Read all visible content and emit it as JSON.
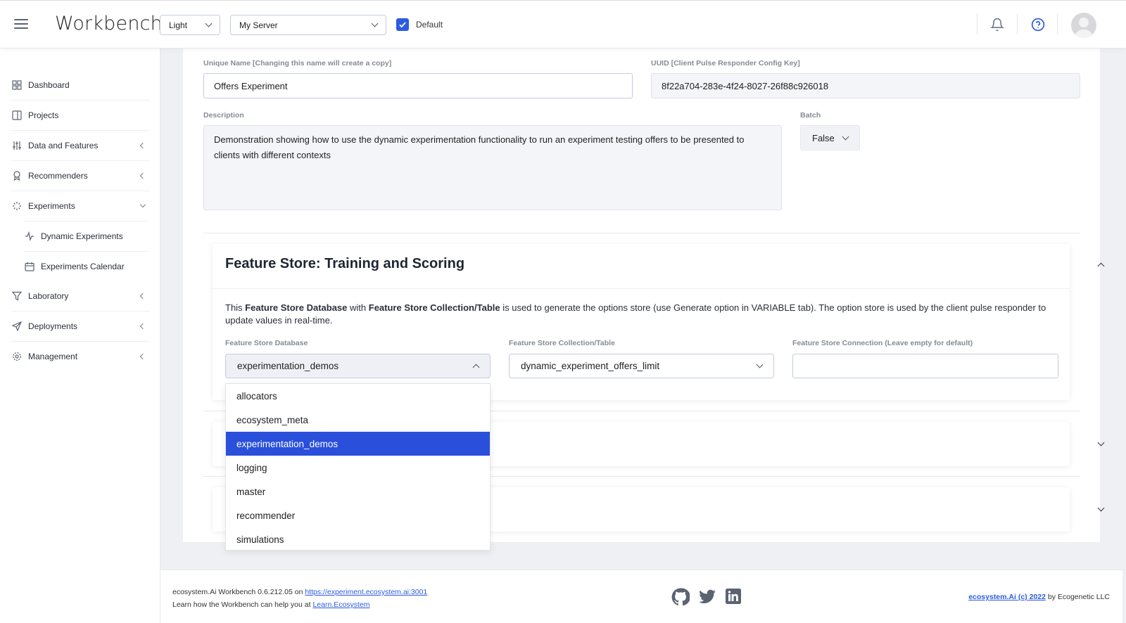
{
  "header": {
    "app_title": "Workbench",
    "theme_value": "Light",
    "server_value": "My Server",
    "default_checked": true,
    "default_label": "Default"
  },
  "sidebar": {
    "items": [
      {
        "label": "Dashboard",
        "icon": "grid-icon"
      },
      {
        "label": "Projects",
        "icon": "project-icon"
      },
      {
        "label": "Data and Features",
        "icon": "sliders-icon"
      },
      {
        "label": "Recommenders",
        "icon": "award-icon"
      },
      {
        "label": "Experiments",
        "icon": "loader-icon"
      },
      {
        "label": "Dynamic Experiments",
        "icon": "activity-icon"
      },
      {
        "label": "Experiments Calendar",
        "icon": "calendar-icon"
      },
      {
        "label": "Laboratory",
        "icon": "filter-icon"
      },
      {
        "label": "Deployments",
        "icon": "send-icon"
      },
      {
        "label": "Management",
        "icon": "settings-icon"
      }
    ]
  },
  "form": {
    "unique_name_label": "Unique Name [Changing this name will create a copy]",
    "unique_name_value": "Offers Experiment",
    "uuid_label": "UUID [Client Pulse Responder Config Key]",
    "uuid_value": "8f22a704-283e-4f24-8027-26f88c926018",
    "description_label": "Description",
    "description_value": "Demonstration showing how to use the dynamic experimentation functionality to run an experiment testing offers to be presented to clients with different contexts",
    "batch_label": "Batch",
    "batch_value": "False"
  },
  "feature_store": {
    "title": "Feature Store: Training and Scoring",
    "desc_1": "This ",
    "desc_b1": "Feature Store Database",
    "desc_2": " with ",
    "desc_b2": "Feature Store Collection/Table",
    "desc_3": " is used to generate the options store (use Generate option in VARIABLE tab). The option store is used by the client pulse responder to update values in real-time.",
    "db_label": "Feature Store Database",
    "db_value": "experimentation_demos",
    "collection_label": "Feature Store Collection/Table",
    "collection_value": "dynamic_experiment_offers_limit",
    "connection_label": "Feature Store Connection (Leave empty for default)",
    "connection_value": "",
    "db_options": [
      "allocators",
      "ecosystem_meta",
      "experimentation_demos",
      "logging",
      "master",
      "recommender",
      "simulations"
    ],
    "db_selected_index": 2
  },
  "footer": {
    "version_text": "ecosystem.Ai Workbench 0.6.212.05 on ",
    "server_link": "https://experiment.ecosystem.ai:3001",
    "learn_text": "Learn how the Workbench can help you at ",
    "learn_link": "Learn.Ecosystem",
    "copyright_link": "ecosystem.Ai (c) 2022",
    "copyright_suffix": " by Ecogenetic LLC",
    "social_icons": [
      "github-icon",
      "twitter-icon",
      "linkedin-icon"
    ]
  }
}
